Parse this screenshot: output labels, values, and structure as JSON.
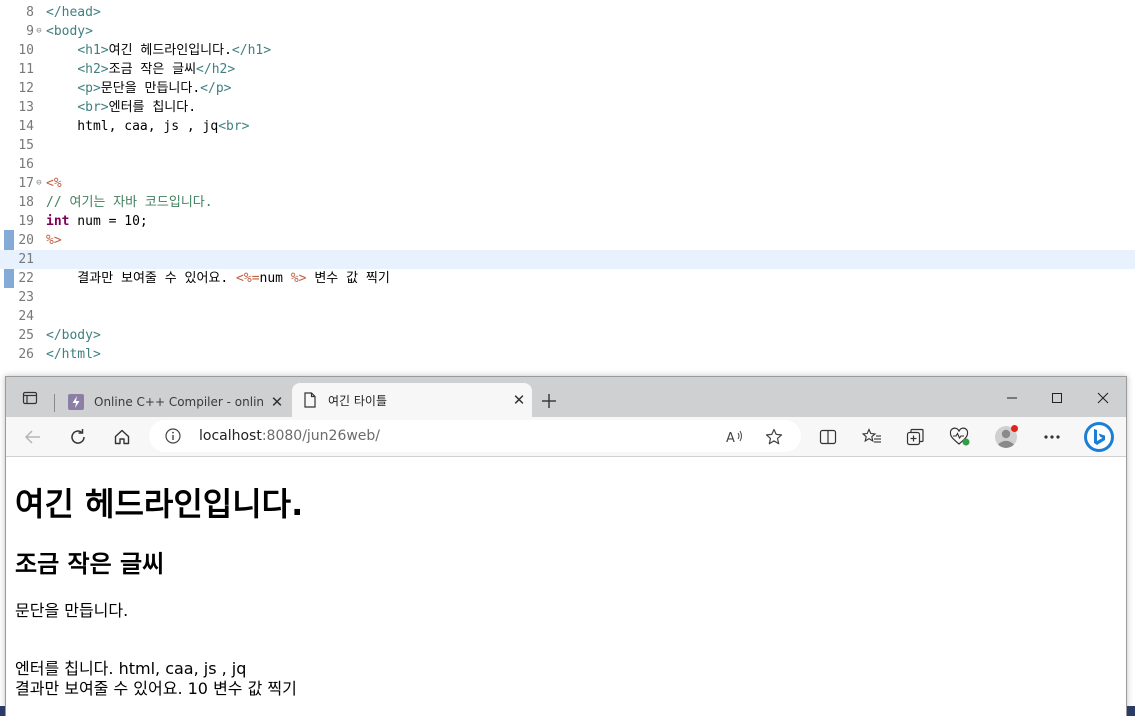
{
  "editor": {
    "lines": [
      {
        "n": "8",
        "fold": "",
        "html": "<span class=\"tag\">&lt;/head&gt;</span>"
      },
      {
        "n": "9",
        "fold": "⊖",
        "html": "<span class=\"tag\">&lt;body&gt;</span>"
      },
      {
        "n": "10",
        "fold": "",
        "html": "    <span class=\"tag\">&lt;h1&gt;</span>여긴 헤드라인입니다.<span class=\"tag\">&lt;/h1&gt;</span>"
      },
      {
        "n": "11",
        "fold": "",
        "html": "    <span class=\"tag\">&lt;h2&gt;</span>조금 작은 글씨<span class=\"tag\">&lt;/h2&gt;</span>"
      },
      {
        "n": "12",
        "fold": "",
        "html": "    <span class=\"tag\">&lt;p&gt;</span>문단을 만듭니다.<span class=\"tag\">&lt;/p&gt;</span>"
      },
      {
        "n": "13",
        "fold": "",
        "html": "    <span class=\"tag\">&lt;br&gt;</span>엔터를 칩니다."
      },
      {
        "n": "14",
        "fold": "",
        "html": "    html, caa, js , jq<span class=\"tag\">&lt;br&gt;</span>"
      },
      {
        "n": "15",
        "fold": "",
        "html": ""
      },
      {
        "n": "16",
        "fold": "",
        "html": ""
      },
      {
        "n": "17",
        "fold": "⊖",
        "html": "<span class=\"jsp\">&lt;%</span>"
      },
      {
        "n": "18",
        "fold": "",
        "html": "<span class=\"cmt\">// 여기는 자바 코드입니다.</span>"
      },
      {
        "n": "19",
        "fold": "",
        "html": "<span class=\"kw\">int</span> num = 10;"
      },
      {
        "n": "20",
        "fold": "",
        "html": "<span class=\"jsp\">%&gt;</span>"
      },
      {
        "n": "21",
        "fold": "",
        "html": "",
        "current": true
      },
      {
        "n": "22",
        "fold": "",
        "html": "    결과만 보여줄 수 있어요. <span class=\"jsp\">&lt;%=</span>num <span class=\"jsp\">%&gt;</span> 변수 값 찍기"
      },
      {
        "n": "23",
        "fold": "",
        "html": ""
      },
      {
        "n": "24",
        "fold": "",
        "html": ""
      },
      {
        "n": "25",
        "fold": "",
        "html": "<span class=\"tag\">&lt;/body&gt;</span>"
      },
      {
        "n": "26",
        "fold": "",
        "html": "<span class=\"tag\">&lt;/html&gt;</span>"
      }
    ]
  },
  "browser": {
    "tabs": {
      "inactive_title": "Online C++ Compiler - online ed",
      "active_title": "여긴 타이틀"
    },
    "address": {
      "host": "localhost",
      "rest": ":8080/jun26web/"
    },
    "icons": {
      "read_aloud": "A̅",
      "read_aloud_label": "A"
    },
    "page": {
      "h1": "여긴 헤드라인입니다.",
      "h2": "조금 작은 글씨",
      "p": "문단을 만듭니다.",
      "line1": "엔터를 칩니다. html, caa, js , jq",
      "line2": "결과만 보여줄 수 있어요. 10 변수 값 찍기"
    },
    "colors": {
      "accent": "#1a73e8",
      "profile_dot": "#e0241b"
    }
  }
}
